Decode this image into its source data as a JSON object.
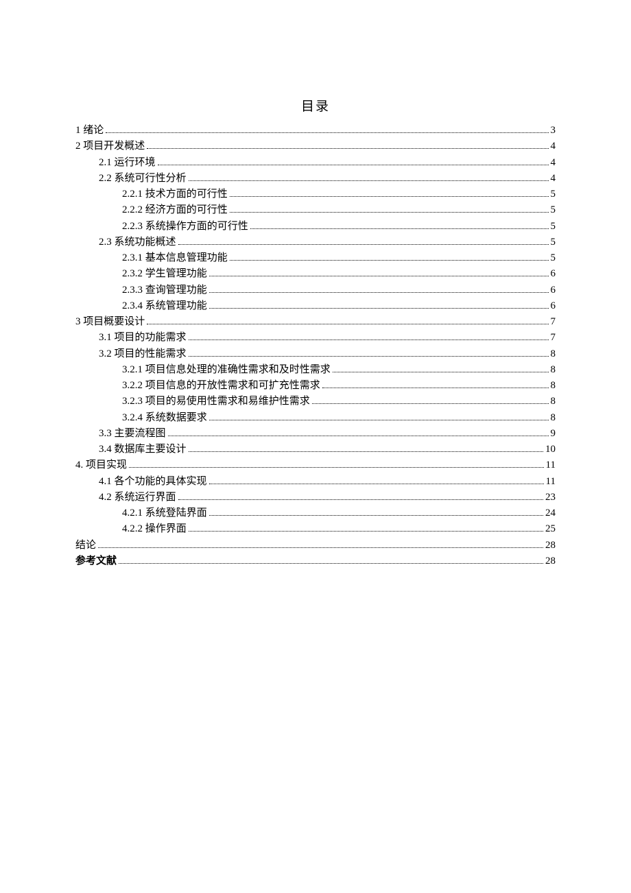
{
  "title": "目录",
  "entries": [
    {
      "level": 1,
      "label": "1  绪论",
      "page": "3"
    },
    {
      "level": 1,
      "label": "2  项目开发概述",
      "page": "4"
    },
    {
      "level": 2,
      "label": "2.1  运行环境",
      "page": "4"
    },
    {
      "level": 2,
      "label": "2.2  系统可行性分析",
      "page": "4"
    },
    {
      "level": 3,
      "label": "2.2.1  技术方面的可行性",
      "page": "5"
    },
    {
      "level": 3,
      "label": "2.2.2  经济方面的可行性",
      "page": "5"
    },
    {
      "level": 3,
      "label": "2.2.3  系统操作方面的可行性",
      "page": "5"
    },
    {
      "level": 2,
      "label": "2.3  系统功能概述",
      "page": "5"
    },
    {
      "level": 3,
      "label": "2.3.1  基本信息管理功能",
      "page": "5"
    },
    {
      "level": 3,
      "label": "2.3.2  学生管理功能",
      "page": "6"
    },
    {
      "level": 3,
      "label": "2.3.3 查询管理功能",
      "page": "6"
    },
    {
      "level": 3,
      "label": "2.3.4  系统管理功能",
      "page": "6"
    },
    {
      "level": 1,
      "label": "3  项目概要设计",
      "page": "7"
    },
    {
      "level": 2,
      "label": "3.1  项目的功能需求",
      "page": "7"
    },
    {
      "level": 2,
      "label": "3.2  项目的性能需求",
      "page": "8"
    },
    {
      "level": 3,
      "label": "3.2.1  项目信息处理的准确性需求和及时性需求",
      "page": "8"
    },
    {
      "level": 3,
      "label": "3.2.2  项目信息的开放性需求和可扩充性需求",
      "page": "8"
    },
    {
      "level": 3,
      "label": "3.2.3 项目的易使用性需求和易维护性需求",
      "page": "8"
    },
    {
      "level": 3,
      "label": "3.2.4  系统数据要求",
      "page": "8"
    },
    {
      "level": 2,
      "label": "3.3  主要流程图",
      "page": "9"
    },
    {
      "level": 2,
      "label": "3.4  数据库主要设计",
      "page": "10"
    },
    {
      "level": 1,
      "label": "4.  项目实现",
      "page": "11"
    },
    {
      "level": 2,
      "label": "4.1  各个功能的具体实现",
      "page": "11"
    },
    {
      "level": 2,
      "label": "4.2  系统运行界面",
      "page": "23"
    },
    {
      "level": 3,
      "label": "4.2.1  系统登陆界面",
      "page": "24"
    },
    {
      "level": 3,
      "label": "4.2.2  操作界面",
      "page": "25"
    },
    {
      "level": 1,
      "label": "结论",
      "page": "28"
    },
    {
      "level": 1,
      "label": "参考文献",
      "page": "28",
      "bold": true
    }
  ]
}
